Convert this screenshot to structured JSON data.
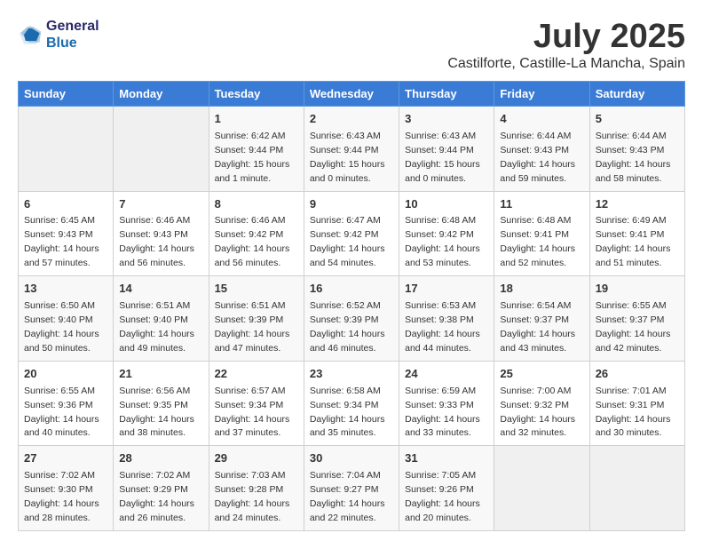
{
  "header": {
    "logo_line1": "General",
    "logo_line2": "Blue",
    "month_year": "July 2025",
    "location": "Castilforte, Castille-La Mancha, Spain"
  },
  "weekdays": [
    "Sunday",
    "Monday",
    "Tuesday",
    "Wednesday",
    "Thursday",
    "Friday",
    "Saturday"
  ],
  "weeks": [
    [
      {
        "day": "",
        "info": ""
      },
      {
        "day": "",
        "info": ""
      },
      {
        "day": "1",
        "info": "Sunrise: 6:42 AM\nSunset: 9:44 PM\nDaylight: 15 hours and 1 minute."
      },
      {
        "day": "2",
        "info": "Sunrise: 6:43 AM\nSunset: 9:44 PM\nDaylight: 15 hours and 0 minutes."
      },
      {
        "day": "3",
        "info": "Sunrise: 6:43 AM\nSunset: 9:44 PM\nDaylight: 15 hours and 0 minutes."
      },
      {
        "day": "4",
        "info": "Sunrise: 6:44 AM\nSunset: 9:43 PM\nDaylight: 14 hours and 59 minutes."
      },
      {
        "day": "5",
        "info": "Sunrise: 6:44 AM\nSunset: 9:43 PM\nDaylight: 14 hours and 58 minutes."
      }
    ],
    [
      {
        "day": "6",
        "info": "Sunrise: 6:45 AM\nSunset: 9:43 PM\nDaylight: 14 hours and 57 minutes."
      },
      {
        "day": "7",
        "info": "Sunrise: 6:46 AM\nSunset: 9:43 PM\nDaylight: 14 hours and 56 minutes."
      },
      {
        "day": "8",
        "info": "Sunrise: 6:46 AM\nSunset: 9:42 PM\nDaylight: 14 hours and 56 minutes."
      },
      {
        "day": "9",
        "info": "Sunrise: 6:47 AM\nSunset: 9:42 PM\nDaylight: 14 hours and 54 minutes."
      },
      {
        "day": "10",
        "info": "Sunrise: 6:48 AM\nSunset: 9:42 PM\nDaylight: 14 hours and 53 minutes."
      },
      {
        "day": "11",
        "info": "Sunrise: 6:48 AM\nSunset: 9:41 PM\nDaylight: 14 hours and 52 minutes."
      },
      {
        "day": "12",
        "info": "Sunrise: 6:49 AM\nSunset: 9:41 PM\nDaylight: 14 hours and 51 minutes."
      }
    ],
    [
      {
        "day": "13",
        "info": "Sunrise: 6:50 AM\nSunset: 9:40 PM\nDaylight: 14 hours and 50 minutes."
      },
      {
        "day": "14",
        "info": "Sunrise: 6:51 AM\nSunset: 9:40 PM\nDaylight: 14 hours and 49 minutes."
      },
      {
        "day": "15",
        "info": "Sunrise: 6:51 AM\nSunset: 9:39 PM\nDaylight: 14 hours and 47 minutes."
      },
      {
        "day": "16",
        "info": "Sunrise: 6:52 AM\nSunset: 9:39 PM\nDaylight: 14 hours and 46 minutes."
      },
      {
        "day": "17",
        "info": "Sunrise: 6:53 AM\nSunset: 9:38 PM\nDaylight: 14 hours and 44 minutes."
      },
      {
        "day": "18",
        "info": "Sunrise: 6:54 AM\nSunset: 9:37 PM\nDaylight: 14 hours and 43 minutes."
      },
      {
        "day": "19",
        "info": "Sunrise: 6:55 AM\nSunset: 9:37 PM\nDaylight: 14 hours and 42 minutes."
      }
    ],
    [
      {
        "day": "20",
        "info": "Sunrise: 6:55 AM\nSunset: 9:36 PM\nDaylight: 14 hours and 40 minutes."
      },
      {
        "day": "21",
        "info": "Sunrise: 6:56 AM\nSunset: 9:35 PM\nDaylight: 14 hours and 38 minutes."
      },
      {
        "day": "22",
        "info": "Sunrise: 6:57 AM\nSunset: 9:34 PM\nDaylight: 14 hours and 37 minutes."
      },
      {
        "day": "23",
        "info": "Sunrise: 6:58 AM\nSunset: 9:34 PM\nDaylight: 14 hours and 35 minutes."
      },
      {
        "day": "24",
        "info": "Sunrise: 6:59 AM\nSunset: 9:33 PM\nDaylight: 14 hours and 33 minutes."
      },
      {
        "day": "25",
        "info": "Sunrise: 7:00 AM\nSunset: 9:32 PM\nDaylight: 14 hours and 32 minutes."
      },
      {
        "day": "26",
        "info": "Sunrise: 7:01 AM\nSunset: 9:31 PM\nDaylight: 14 hours and 30 minutes."
      }
    ],
    [
      {
        "day": "27",
        "info": "Sunrise: 7:02 AM\nSunset: 9:30 PM\nDaylight: 14 hours and 28 minutes."
      },
      {
        "day": "28",
        "info": "Sunrise: 7:02 AM\nSunset: 9:29 PM\nDaylight: 14 hours and 26 minutes."
      },
      {
        "day": "29",
        "info": "Sunrise: 7:03 AM\nSunset: 9:28 PM\nDaylight: 14 hours and 24 minutes."
      },
      {
        "day": "30",
        "info": "Sunrise: 7:04 AM\nSunset: 9:27 PM\nDaylight: 14 hours and 22 minutes."
      },
      {
        "day": "31",
        "info": "Sunrise: 7:05 AM\nSunset: 9:26 PM\nDaylight: 14 hours and 20 minutes."
      },
      {
        "day": "",
        "info": ""
      },
      {
        "day": "",
        "info": ""
      }
    ]
  ]
}
